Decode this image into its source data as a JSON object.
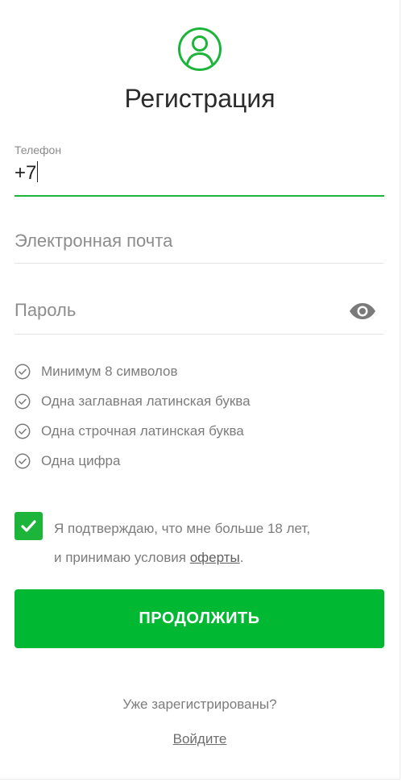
{
  "colors": {
    "accent": "#1db43a",
    "button": "#01b833",
    "text_muted": "#7c7c7c"
  },
  "header": {
    "icon": "user-circle-icon",
    "title": "Регистрация"
  },
  "form": {
    "phone": {
      "label": "Телефон",
      "value": "+7"
    },
    "email": {
      "placeholder": "Электронная почта"
    },
    "password": {
      "placeholder": "Пароль",
      "toggle_icon": "eye-icon"
    }
  },
  "password_rules": [
    {
      "text": "Минимум 8 символов",
      "icon": "check-circle-icon"
    },
    {
      "text": "Одна заглавная латинская буква",
      "icon": "check-circle-icon"
    },
    {
      "text": "Одна строчная латинская буква",
      "icon": "check-circle-icon"
    },
    {
      "text": "Одна цифра",
      "icon": "check-circle-icon"
    }
  ],
  "agreement": {
    "checked": true,
    "line1": "Я подтверждаю, что мне больше 18 лет,",
    "line2_prefix": "и принимаю условия ",
    "link_text": "оферты",
    "line2_suffix": "."
  },
  "actions": {
    "continue_label": "ПРОДОЛЖИТЬ"
  },
  "footer": {
    "already_text": "Уже зарегистрированы?",
    "login_link": "Войдите"
  }
}
